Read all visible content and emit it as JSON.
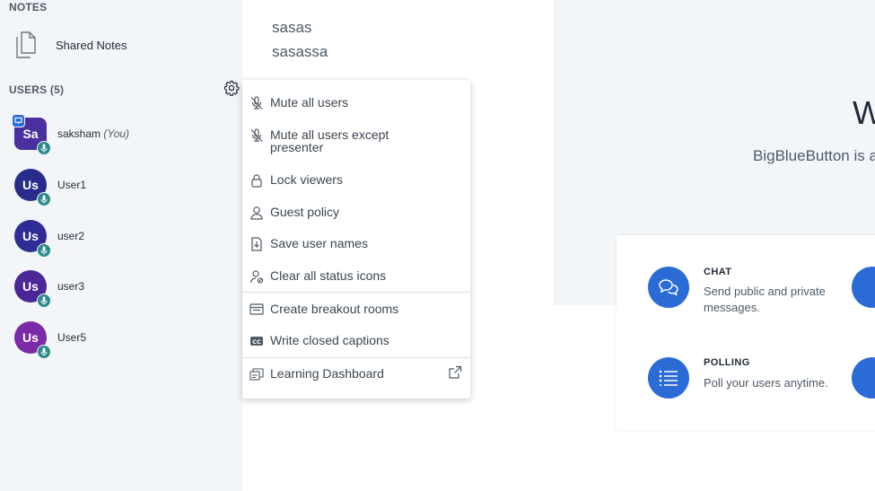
{
  "sidebar": {
    "notes_heading": "NOTES",
    "shared_notes_label": "Shared Notes",
    "users_heading": "USERS (5)",
    "users": [
      {
        "initials": "Sa",
        "name": "saksham",
        "suffix": "(You)",
        "color": "#4a2fa0",
        "presenter": true
      },
      {
        "initials": "Us",
        "name": "User1",
        "suffix": "",
        "color": "#2a2c8c"
      },
      {
        "initials": "Us",
        "name": "user2",
        "suffix": "",
        "color": "#2f2c96"
      },
      {
        "initials": "Us",
        "name": "user3",
        "suffix": "",
        "color": "#4a2696"
      },
      {
        "initials": "Us",
        "name": "User5",
        "suffix": "",
        "color": "#7b2ba8"
      }
    ]
  },
  "notes_pad": {
    "lines": [
      "sasas",
      "sasassa"
    ]
  },
  "menu": {
    "items": [
      {
        "label": "Mute all users",
        "icon": "mic-off-icon"
      },
      {
        "label": "Mute all users except presenter",
        "icon": "mic-off-icon"
      },
      {
        "label": "Lock viewers",
        "icon": "lock-icon"
      },
      {
        "label": "Guest policy",
        "icon": "user-icon"
      },
      {
        "label": "Save user names",
        "icon": "download-file-icon"
      },
      {
        "label": "Clear all status icons",
        "icon": "clear-status-icon"
      },
      {
        "label": "Create breakout rooms",
        "icon": "breakout-rooms-icon"
      },
      {
        "label": "Write closed captions",
        "icon": "closed-captions-icon"
      },
      {
        "label": "Learning Dashboard",
        "icon": "dashboard-icon"
      }
    ]
  },
  "presentation": {
    "welcome_title": "W",
    "welcome_sub": "BigBlueButton is a",
    "features": [
      {
        "title": "CHAT",
        "desc": "Send public and private messages.",
        "icon": "chat-icon"
      },
      {
        "title": "POLLING",
        "desc": "Poll your users anytime.",
        "icon": "list-icon"
      }
    ]
  },
  "colors": {
    "accent": "#2b6bd6",
    "mic_badge": "#2a8c8a",
    "sidebar_bg": "#f3f6f9"
  }
}
